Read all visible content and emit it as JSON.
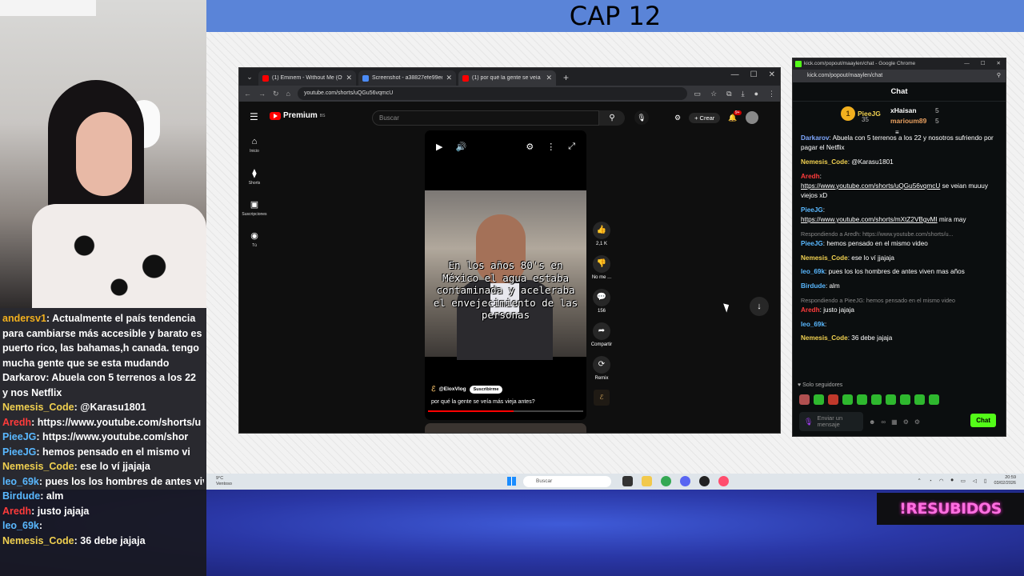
{
  "overlay": {
    "title": "CAP 12",
    "badge_text": "!RESUBIDOS"
  },
  "left_chat": [
    {
      "user": "andersv1",
      "color": "#f2b01e",
      "text": ": Actualmente el país tendencia para cambiarse más accesible y barato es puerto rico, las bahamas,h canada. tengo mucha gente que se esta mudando"
    },
    {
      "user": "Darkarov",
      "color": "#ffffff",
      "text": ": Abuela con 5 terrenos a los 22 y nos Netflix"
    },
    {
      "user": "Nemesis_Code",
      "color": "#f0d050",
      "text": ": @Karasu1801"
    },
    {
      "user": "Aredh",
      "color": "#ff3b3b",
      "text": ": https://www.youtube.com/shorts/u"
    },
    {
      "user": "PieeJG",
      "color": "#59b8ff",
      "text": ": https://www.youtube.com/shor"
    },
    {
      "user": "PieeJG",
      "color": "#59b8ff",
      "text": ": hemos pensado en el mismo vi"
    },
    {
      "user": "Nemesis_Code",
      "color": "#f0d050",
      "text": ": ese lo ví jjajaja"
    },
    {
      "user": "leo_69k",
      "color": "#59b8ff",
      "text": ": pues los los hombres de antes vive"
    },
    {
      "user": "Birdude",
      "color": "#59b8ff",
      "text": ": alm"
    },
    {
      "user": "Aredh",
      "color": "#ff3b3b",
      "text": ": justo jajaja"
    },
    {
      "user": "leo_69k",
      "color": "#59b8ff",
      "text": ":"
    },
    {
      "user": "Nemesis_Code",
      "color": "#f0d050",
      "text": ": 36 debe jajaja"
    }
  ],
  "browser": {
    "tabs": [
      {
        "label": "(1) Eminem - Without Me (Offi",
        "color": "#ff0000"
      },
      {
        "label": "Screenshot - a38827efe99eebd",
        "color": "#4b8bf5"
      },
      {
        "label": "(1) por qué la gente se veía más",
        "color": "#ff0000"
      }
    ],
    "url": "youtube.com/shorts/uQGu56vqmcU"
  },
  "youtube": {
    "logo": "Premium",
    "logo_sup": "BS",
    "search_placeholder": "Buscar",
    "create_label": "Crear",
    "notif_count": "9+",
    "sidebar": [
      {
        "label": "Inicio",
        "icon": "home-icon",
        "glyph": "⌂"
      },
      {
        "label": "Shorts",
        "icon": "shorts-icon",
        "glyph": "⧫"
      },
      {
        "label": "Suscripciones",
        "icon": "subscriptions-icon",
        "glyph": "▣"
      },
      {
        "label": "Tú",
        "icon": "user-icon",
        "glyph": "◉"
      }
    ],
    "short": {
      "caption": "En los años 80's en México el agua estaba contaminada y aceleraba el envejecimiento de las personas",
      "channel": "@EloxVlog",
      "subscribe": "Suscribirme",
      "title": "por qué la gente se veía más vieja antes?",
      "progress": 0.55
    },
    "actions": [
      {
        "label": "2,1 K",
        "glyph": "👍",
        "name": "like-button"
      },
      {
        "label": "No me ...",
        "glyph": "👎",
        "name": "dislike-button"
      },
      {
        "label": "156",
        "glyph": "💬",
        "name": "comments-button"
      },
      {
        "label": "Compartir",
        "glyph": "➦",
        "name": "share-button"
      },
      {
        "label": "Remix",
        "glyph": "⟳",
        "name": "remix-button"
      }
    ]
  },
  "kick": {
    "window_title": "kick.com/popout/maaylen/chat - Google Chrome",
    "url": "kick.com/popout/maaylen/chat",
    "header": "Chat",
    "top_gifter": {
      "name": "PieeJG",
      "count": "35"
    },
    "gifters": [
      {
        "name": "xHaisan",
        "count": "5"
      },
      {
        "name": "marioum89",
        "count": "5"
      }
    ],
    "messages": [
      {
        "user": "Darkarov",
        "color": "#7fa8ff",
        "text": ": Abuela con 5 terrenos a los 22 y nosotros sufriendo por pagar el Netflix"
      },
      {
        "user": "Nemesis_Code",
        "color": "#f0d050",
        "text": ": @Karasu1801"
      },
      {
        "user": "Aredh",
        "color": "#ff3b3b",
        "text": ":",
        "link": "https://www.youtube.com/shorts/uQGu56vqmcU",
        "after": " se veian muuuy viejos xD"
      },
      {
        "user": "PieeJG",
        "color": "#59b8ff",
        "text": ":",
        "link": "https://www.youtube.com/shorts/mXtZ2VBgvMI",
        "after": " mira may"
      },
      {
        "reply": "Respondiendo a Aredh: https://www.youtube.com/shorts/u...",
        "user": "PieeJG",
        "color": "#59b8ff",
        "text": ": hemos pensado en el mismo video"
      },
      {
        "user": "Nemesis_Code",
        "color": "#f0d050",
        "text": ": ese lo ví jjajaja"
      },
      {
        "user": "leo_69k",
        "color": "#59b8ff",
        "text": ": pues los los hombres de antes viven mas años"
      },
      {
        "user": "Birdude",
        "color": "#59b8ff",
        "text": ": alm"
      },
      {
        "reply": "Respondiendo a PieeJG: hemos pensado en el mismo video",
        "user": "Aredh",
        "color": "#ff3b3b",
        "text": ": justo jajaja"
      },
      {
        "user": "leo_69k",
        "color": "#59b8ff",
        "text": ":"
      },
      {
        "user": "Nemesis_Code",
        "color": "#f0d050",
        "text": ": 36 debe jajaja"
      }
    ],
    "followers_only": "Solo seguidores",
    "input_placeholder": "Enviar un mensaje",
    "chat_button": "Chat"
  },
  "taskbar": {
    "weather_temp": "9°C",
    "weather_desc": "Ventoso",
    "search": "Buscar",
    "time": "20:59",
    "date": "03/02/2026"
  }
}
